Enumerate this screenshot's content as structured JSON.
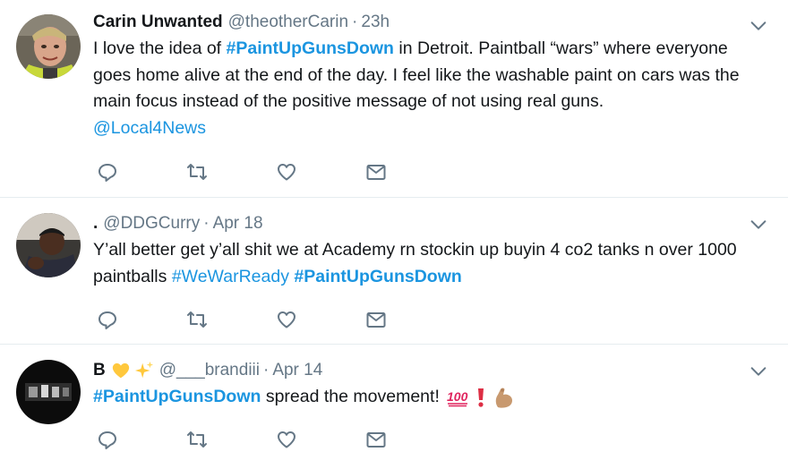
{
  "tweets": [
    {
      "name": "Carin Unwanted",
      "handle": "@theotherCarin",
      "time": "23h",
      "body_before": "I love the idea of ",
      "hashtag": "#PaintUpGunsDown",
      "body_after": " in Detroit. Paintball “wars” where everyone goes home alive at the end of the day. I feel like the washable paint on cars was the main focus instead of the positive message of not using real guns.",
      "mention": "@Local4News"
    },
    {
      "name": ".",
      "handle": "@DDGCurry",
      "time": "Apr 18",
      "body": "Y’all better get y’all shit we at Academy rn stockin up buyin 4 co2 tanks n over 1000 paintballs ",
      "hashtag1": "#WeWarReady",
      "hashtag2": "#PaintUpGunsDown"
    },
    {
      "name": "B",
      "handle": "@___brandiii",
      "time": "Apr 14",
      "hashtag": "#PaintUpGunsDown",
      "body": " spread the movement! "
    }
  ],
  "dot": "·",
  "colors": {
    "link": "#1b95e0",
    "secondary": "#657786",
    "divider": "#e6ecf0",
    "icon": "#657786"
  },
  "icons": [
    "reply-icon",
    "retweet-icon",
    "like-icon",
    "message-icon",
    "chevron-down-icon",
    "yellow-heart-icon",
    "sparkles-icon",
    "hundred-points-icon",
    "exclamation-icon",
    "flexed-biceps-icon"
  ]
}
